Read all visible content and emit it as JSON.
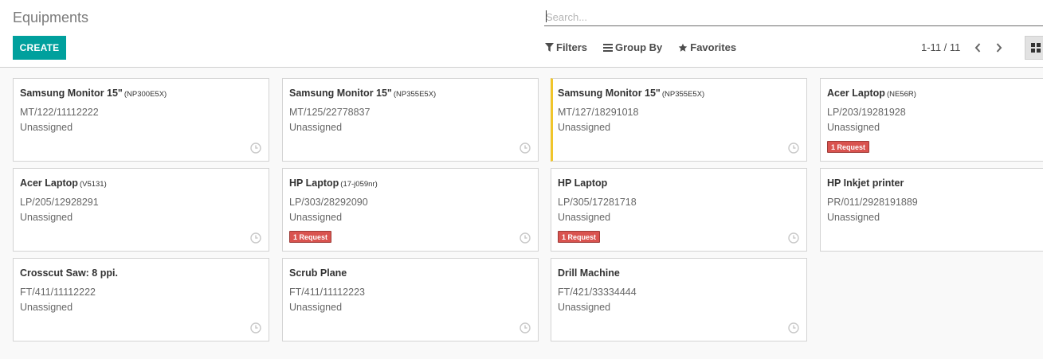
{
  "breadcrumb": "Equipments",
  "create_label": "CREATE",
  "search": {
    "placeholder": "Search..."
  },
  "search_options": {
    "filters": "Filters",
    "group_by": "Group By",
    "favorites": "Favorites"
  },
  "pager": {
    "value": "1-11 / 11"
  },
  "colors": {
    "primary": "#00a09d",
    "badge": "#d9534f",
    "flag": "#f0c52b"
  },
  "cards": [
    {
      "name": "Samsung Monitor 15\"",
      "model": "(NP300E5X)",
      "serial": "MT/122/11112222",
      "assigned": "Unassigned",
      "badge": "",
      "flagged": false
    },
    {
      "name": "Samsung Monitor 15\"",
      "model": "(NP355E5X)",
      "serial": "MT/125/22778837",
      "assigned": "Unassigned",
      "badge": "",
      "flagged": false
    },
    {
      "name": "Samsung Monitor 15\"",
      "model": "(NP355E5X)",
      "serial": "MT/127/18291018",
      "assigned": "Unassigned",
      "badge": "",
      "flagged": true
    },
    {
      "name": "Acer Laptop",
      "model": "(NE56R)",
      "serial": "LP/203/19281928",
      "assigned": "Unassigned",
      "badge": "1 Request",
      "flagged": false
    },
    {
      "name": "Acer Laptop",
      "model": "(V5131)",
      "serial": "LP/205/12928291",
      "assigned": "Unassigned",
      "badge": "",
      "flagged": false
    },
    {
      "name": "HP Laptop",
      "model": "(17-j059nr)",
      "serial": "LP/303/28292090",
      "assigned": "Unassigned",
      "badge": "1 Request",
      "flagged": false
    },
    {
      "name": "HP Laptop",
      "model": "",
      "serial": "LP/305/17281718",
      "assigned": "Unassigned",
      "badge": "1 Request",
      "flagged": false
    },
    {
      "name": "HP Inkjet printer",
      "model": "",
      "serial": "PR/011/2928191889",
      "assigned": "Unassigned",
      "badge": "",
      "flagged": false
    },
    {
      "name": "Crosscut Saw: 8 ppi.",
      "model": "",
      "serial": "FT/411/11112222",
      "assigned": "Unassigned",
      "badge": "",
      "flagged": false
    },
    {
      "name": "Scrub Plane",
      "model": "",
      "serial": "FT/411/11112223",
      "assigned": "Unassigned",
      "badge": "",
      "flagged": false
    },
    {
      "name": "Drill Machine",
      "model": "",
      "serial": "FT/421/33334444",
      "assigned": "Unassigned",
      "badge": "",
      "flagged": false
    }
  ]
}
